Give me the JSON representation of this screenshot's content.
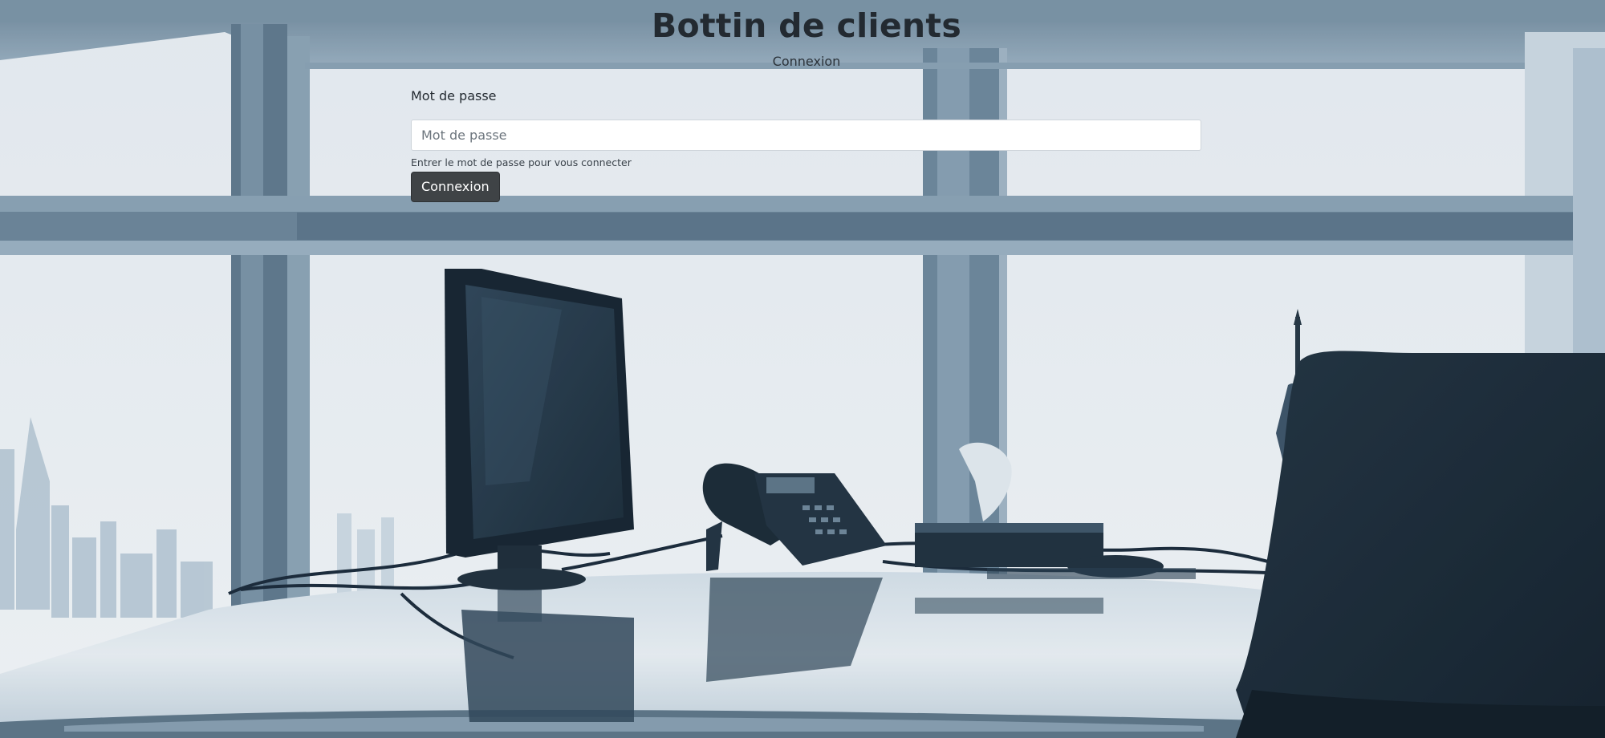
{
  "header": {
    "title": "Bottin de clients",
    "subtitle": "Connexion"
  },
  "login_form": {
    "password_label": "Mot de passe",
    "password_placeholder": "Mot de passe",
    "password_value": "",
    "help_text": "Entrer le mot de passe pour vous connecter",
    "submit_label": "Connexion"
  },
  "colors": {
    "title_text": "#232a31",
    "button_bg": "#3f4346",
    "button_text": "#ffffff",
    "scene_tint": "#5d7a92"
  },
  "background": {
    "icons": [
      "office-window-icon",
      "monitor-icon",
      "desk-phone-icon",
      "tissue-box-icon",
      "office-chair-icon"
    ]
  }
}
